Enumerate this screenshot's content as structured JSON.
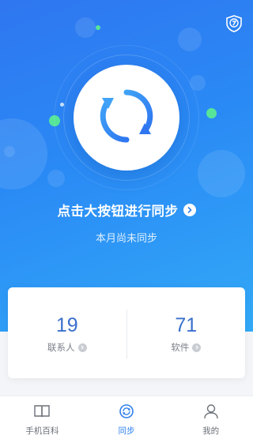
{
  "main": {
    "title": "点击大按钮进行同步",
    "subtitle": "本月尚未同步"
  },
  "stats": [
    {
      "value": "19",
      "label": "联系人"
    },
    {
      "value": "71",
      "label": "软件"
    }
  ],
  "tabbar": {
    "items": [
      {
        "label": "手机百科",
        "icon": "book-icon",
        "active": false
      },
      {
        "label": "同步",
        "icon": "sync-icon",
        "active": true
      },
      {
        "label": "我的",
        "icon": "person-icon",
        "active": false
      }
    ]
  },
  "colors": {
    "brand_blue": "#2f80ed",
    "hero_start": "#2f76f0",
    "hero_end": "#32a9f7",
    "accent_green": "#57e59a",
    "stat_value": "#3a6fcc"
  }
}
